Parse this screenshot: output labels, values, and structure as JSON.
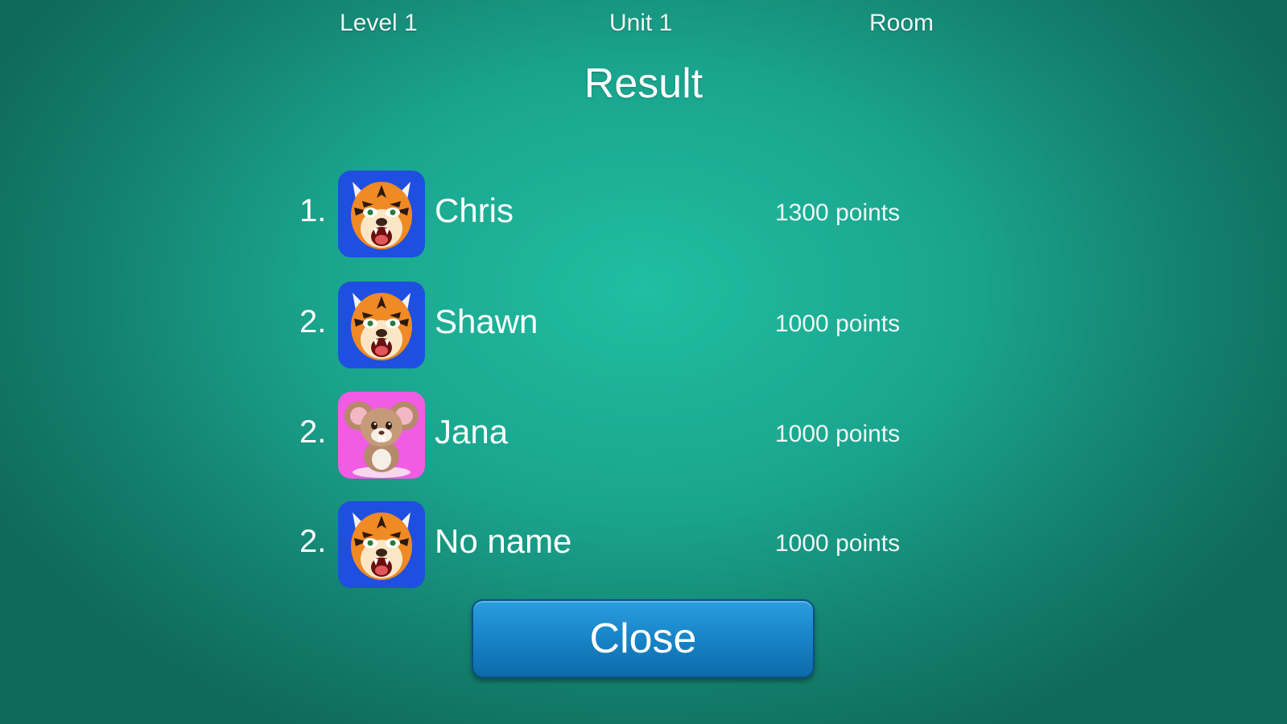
{
  "header": {
    "level": "Level 1",
    "unit": "Unit 1",
    "room": "Room"
  },
  "title": "Result",
  "players": [
    {
      "rank": "1.",
      "name": "Chris",
      "points": "1300 points",
      "avatar": "tiger-icon"
    },
    {
      "rank": "2.",
      "name": "Shawn",
      "points": "1000 points",
      "avatar": "tiger-icon"
    },
    {
      "rank": "2.",
      "name": "Jana",
      "points": "1000 points",
      "avatar": "mouse-icon"
    },
    {
      "rank": "2.",
      "name": "No name",
      "points": "1000 points",
      "avatar": "tiger-icon"
    }
  ],
  "close_label": "Close",
  "colors": {
    "background": "#1aa48d",
    "tiger_avatar_bg": "#1f4fe0",
    "mouse_avatar_bg": "#f25be4",
    "close_button": "#1784c7"
  }
}
